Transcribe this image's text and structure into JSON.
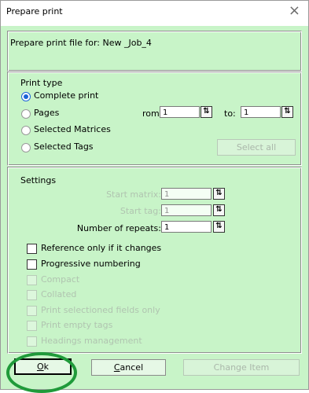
{
  "window": {
    "title": "Prepare print",
    "close_glyph": "×"
  },
  "header": {
    "prepare_label": "Prepare print file for: New _Job_4"
  },
  "print_type": {
    "group_label": "Print type",
    "options": [
      {
        "label": "Complete print",
        "selected": true
      },
      {
        "label": "Pages",
        "selected": false
      },
      {
        "label": "Selected Matrices",
        "selected": false
      },
      {
        "label": "Selected Tags",
        "selected": false
      }
    ],
    "from_label": "rom:",
    "from_value": "1",
    "to_label": "to:",
    "to_value": "1",
    "select_all_label": "Select all"
  },
  "settings": {
    "group_label": "Settings",
    "start_matrix_label": "Start matrix:",
    "start_matrix_value": "1",
    "start_tag_label": "Start tag:",
    "start_tag_value": "1",
    "repeats_label": "Number of repeats:",
    "repeats_value": "1",
    "checkboxes": [
      {
        "label": "Reference only if it changes",
        "enabled": true
      },
      {
        "label": "Progressive numbering",
        "enabled": true
      },
      {
        "label": "Compact",
        "enabled": false
      },
      {
        "label": "Collated",
        "enabled": false
      },
      {
        "label": "Print selectioned fields only",
        "enabled": false
      },
      {
        "label": "Print empty tags",
        "enabled": false
      },
      {
        "label": "Headings management",
        "enabled": false
      }
    ]
  },
  "buttons": {
    "ok": "Ok",
    "cancel": "Cancel",
    "change_item": "Change Item"
  },
  "icons": {
    "spin": "spin-arrows-icon",
    "close": "close-icon"
  },
  "colors": {
    "client_bg": "#c8f4c8",
    "radio_selected": "#1a63d6",
    "highlight_circle": "#1f9a3a"
  }
}
